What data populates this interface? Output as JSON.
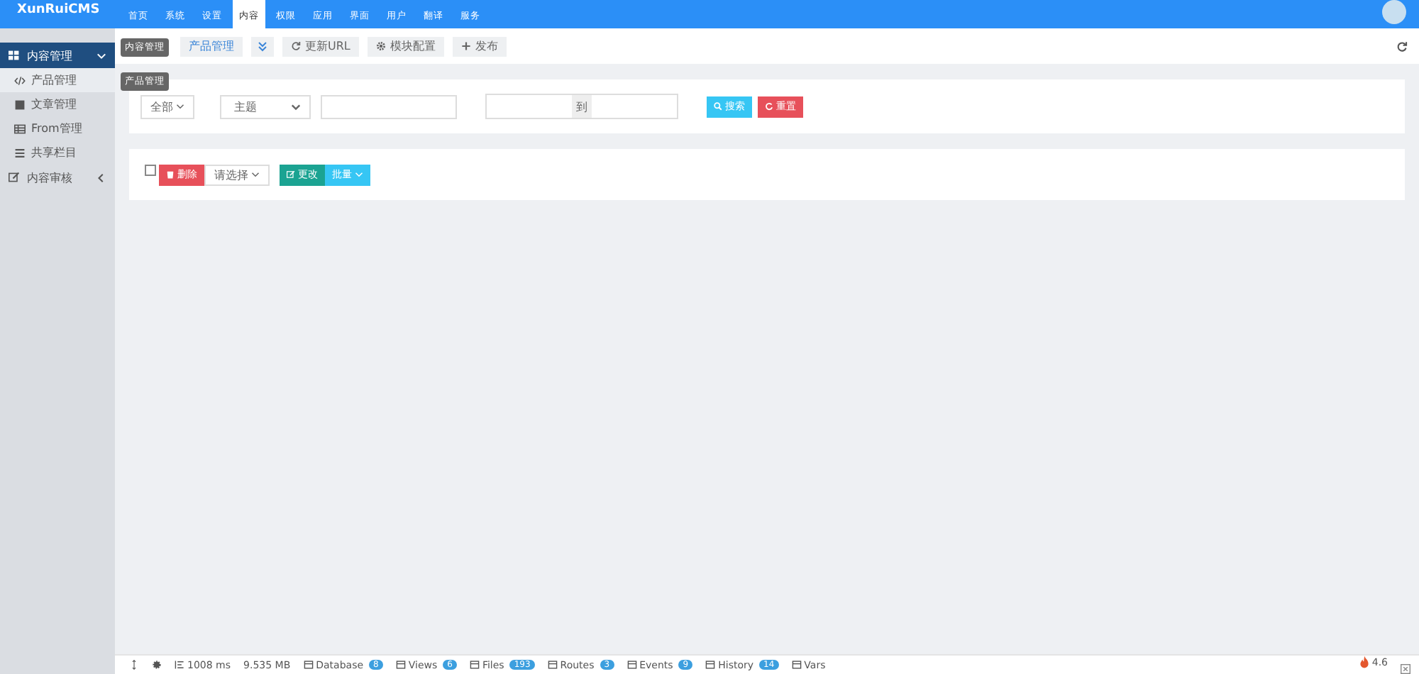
{
  "logo": {
    "text": "XunRuiCMS"
  },
  "nav": [
    {
      "label": "首页",
      "selected": false
    },
    {
      "label": "系统",
      "selected": false
    },
    {
      "label": "设置",
      "selected": false
    },
    {
      "label": "内容",
      "selected": true
    },
    {
      "label": "权限",
      "selected": false
    },
    {
      "label": "应用",
      "selected": false
    },
    {
      "label": "界面",
      "selected": false
    },
    {
      "label": "用户",
      "selected": false
    },
    {
      "label": "翻译",
      "selected": false
    },
    {
      "label": "服务",
      "selected": false
    }
  ],
  "sidebar": {
    "items": [
      {
        "label": "内容管理",
        "kind": "grid",
        "selected": true,
        "expanded": true,
        "children": [
          {
            "label": "产品管理",
            "kind": "code",
            "selected": true
          },
          {
            "label": "文章管理",
            "kind": "square",
            "selected": false
          },
          {
            "label": "From管理",
            "kind": "table",
            "selected": false
          },
          {
            "label": "共享栏目",
            "kind": "list",
            "selected": false
          }
        ]
      },
      {
        "label": "内容审核",
        "kind": "edit",
        "selected": false,
        "expanded": false
      }
    ]
  },
  "tooltips": [
    "内容管理",
    "产品管理"
  ],
  "toolbar": {
    "tabs": [
      {
        "label": "产品管理",
        "selected": true
      }
    ],
    "buttons": [
      {
        "label": "更新URL",
        "kind": "refresh"
      },
      {
        "label": "模块配置",
        "kind": "gear"
      },
      {
        "label": "发布",
        "kind": "plus"
      }
    ]
  },
  "filter": {
    "scope": "全部",
    "field": "主题",
    "range_separator": "到",
    "search": "搜索",
    "reset": "重置"
  },
  "actions": {
    "checked": false,
    "delete": "删除",
    "choose": "请选择",
    "change": "更改",
    "batch": "批量"
  },
  "debug_bar": {
    "time": "1008 ms",
    "memory": "9.535 MB",
    "items": [
      {
        "label": "Database",
        "count": "8"
      },
      {
        "label": "Views",
        "count": "6"
      },
      {
        "label": "Files",
        "count": "193"
      },
      {
        "label": "Routes",
        "count": "3"
      },
      {
        "label": "Events",
        "count": "9"
      },
      {
        "label": "History",
        "count": "14"
      },
      {
        "label": "Vars"
      }
    ],
    "version": "4.6"
  }
}
